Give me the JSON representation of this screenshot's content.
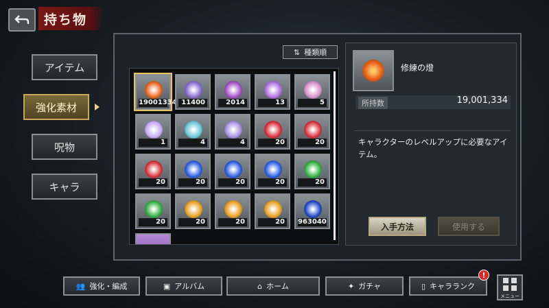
{
  "header": {
    "title": "持ち物"
  },
  "tabs": [
    {
      "label": "アイテム",
      "active": false
    },
    {
      "label": "強化素材",
      "active": true
    },
    {
      "label": "呪物",
      "active": false
    },
    {
      "label": "キャラ",
      "active": false
    }
  ],
  "sort_label": "種類順",
  "items": [
    {
      "count": "19001334",
      "color": "#e8621c"
    },
    {
      "count": "11400",
      "color": "#8a6ad0"
    },
    {
      "count": "2014",
      "color": "#a450c8"
    },
    {
      "count": "13",
      "color": "#b070e0"
    },
    {
      "count": "5",
      "color": "#d890c8"
    },
    {
      "count": "1",
      "color": "#c8a8f0"
    },
    {
      "count": "4",
      "color": "#68c8d8"
    },
    {
      "count": "4",
      "color": "#a890e0"
    },
    {
      "count": "20",
      "color": "#d8303a"
    },
    {
      "count": "20",
      "color": "#d8303a"
    },
    {
      "count": "20",
      "color": "#d8303a"
    },
    {
      "count": "20",
      "color": "#2a5ee0"
    },
    {
      "count": "20",
      "color": "#2a5ee0"
    },
    {
      "count": "20",
      "color": "#2a5ee0"
    },
    {
      "count": "20",
      "color": "#30b040"
    },
    {
      "count": "20",
      "color": "#30b040"
    },
    {
      "count": "20",
      "color": "#e8a020"
    },
    {
      "count": "20",
      "color": "#e8a020"
    },
    {
      "count": "20",
      "color": "#e8a020"
    },
    {
      "count": "963040",
      "color": "#2048c8"
    }
  ],
  "detail": {
    "name": "修練の燈",
    "owned_label": "所持数",
    "owned_value": "19,001,334",
    "description": "キャラクターのレベルアップに必要なアイテム。",
    "how_to_get": "入手方法",
    "use": "使用する"
  },
  "bottom_nav": [
    {
      "label": "強化・編成"
    },
    {
      "label": "アルバム"
    },
    {
      "label": "ホーム"
    },
    {
      "label": "ガチャ"
    },
    {
      "label": "キャラランク"
    }
  ],
  "menu_label": "メニュー",
  "badge": "!"
}
